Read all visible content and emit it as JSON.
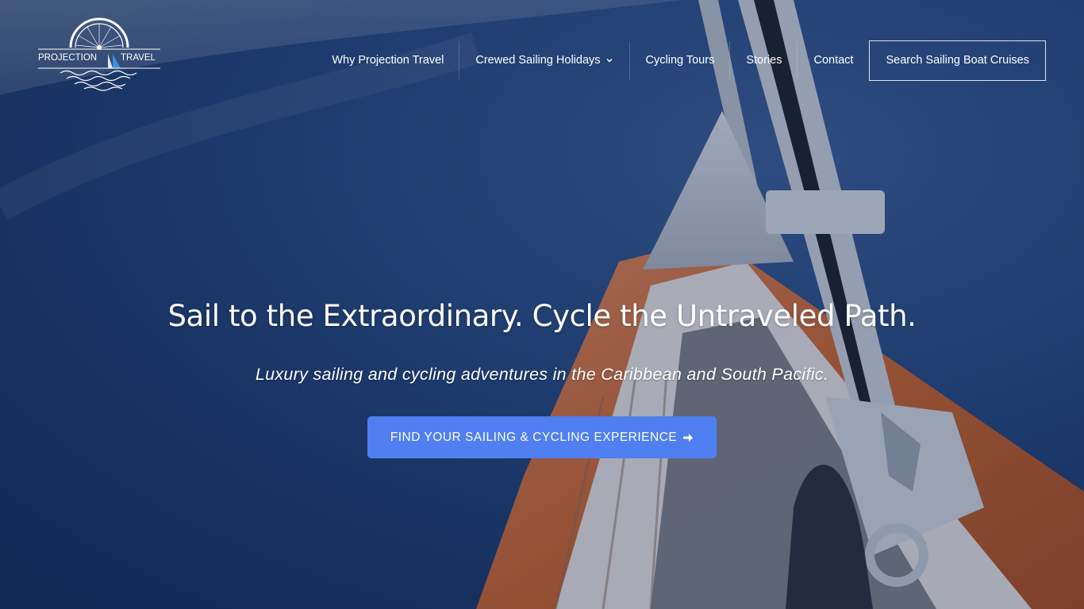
{
  "brand": {
    "logo_text_left": "PROJECTION",
    "logo_text_right": "TRAVEL"
  },
  "nav": {
    "items": [
      {
        "label": "Why Projection Travel"
      },
      {
        "label": "Crewed Sailing Holidays",
        "has_dropdown": true
      },
      {
        "label": "Cycling Tours"
      },
      {
        "label": "Stories"
      },
      {
        "label": "Contact"
      }
    ],
    "search_button": "Search Sailing Boat Cruises"
  },
  "hero": {
    "headline": "Sail to the Extraordinary. Cycle the Untraveled Path.",
    "subheadline": "Luxury sailing and cycling adventures in the Caribbean and South Pacific.",
    "cta_label": "FIND YOUR SAILING & CYCLING EXPERIENCE",
    "cta_icon": "arrow-right-icon"
  },
  "colors": {
    "ocean": "#1b3563",
    "cta": "#4f7ff0",
    "hull": "#c8622a",
    "logo_sail": "#3b8fd6"
  }
}
